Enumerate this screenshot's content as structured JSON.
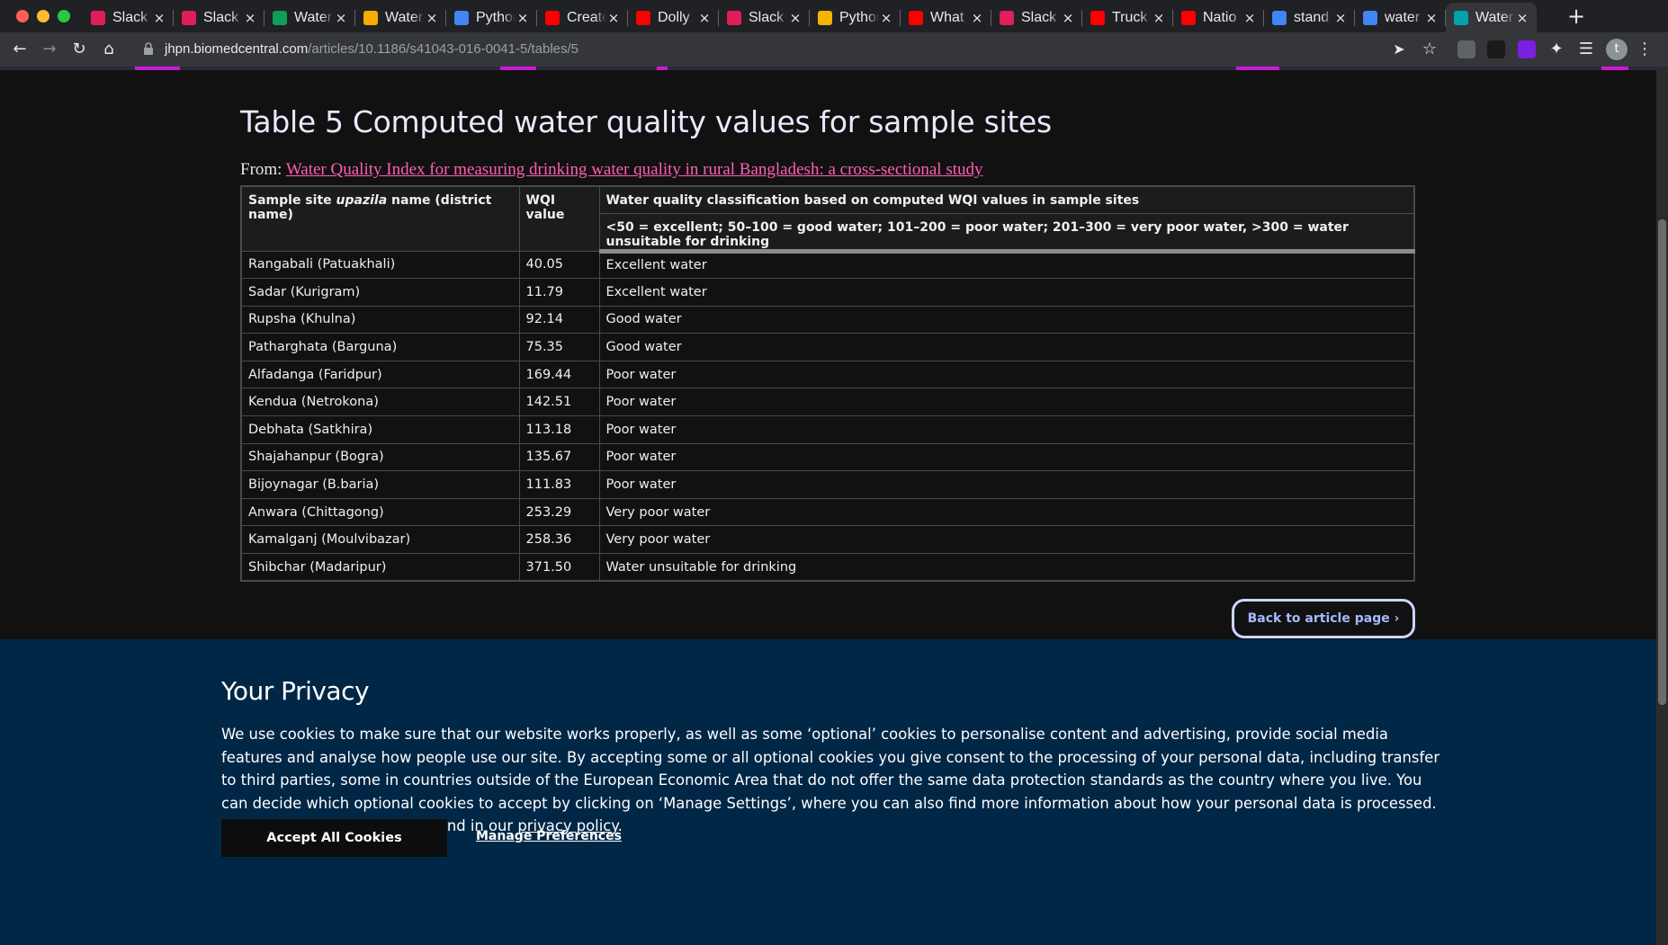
{
  "browser": {
    "tabs": [
      {
        "title": "Slack",
        "icon": "slack-icon",
        "color": "#e01e5a"
      },
      {
        "title": "Slack",
        "icon": "slack-icon",
        "color": "#e01e5a"
      },
      {
        "title": "Water",
        "icon": "sheets-icon",
        "color": "#0f9d58"
      },
      {
        "title": "Water",
        "icon": "colab-icon",
        "color": "#f9ab00"
      },
      {
        "title": "Python",
        "icon": "docs-icon",
        "color": "#4285f4"
      },
      {
        "title": "Create",
        "icon": "youtube-icon",
        "color": "#ff0000"
      },
      {
        "title": "Dolly",
        "icon": "youtube-icon",
        "color": "#ff0000"
      },
      {
        "title": "Slack",
        "icon": "slack-icon",
        "color": "#e01e5a"
      },
      {
        "title": "Python",
        "icon": "slides-icon",
        "color": "#f4b400"
      },
      {
        "title": "What",
        "icon": "youtube-icon",
        "color": "#ff0000"
      },
      {
        "title": "Slack",
        "icon": "slack-icon",
        "color": "#e01e5a"
      },
      {
        "title": "Truck",
        "icon": "youtube-icon",
        "color": "#ff0000"
      },
      {
        "title": "Natio",
        "icon": "youtube-icon",
        "color": "#ff0000"
      },
      {
        "title": "stand",
        "icon": "google-icon",
        "color": "#4285f4"
      },
      {
        "title": "water",
        "icon": "google-icon",
        "color": "#4285f4"
      },
      {
        "title": "Water",
        "icon": "biomedcentral-icon",
        "color": "#00a3ad"
      }
    ],
    "url_host": "jhpn.biomedcentral.com",
    "url_path": "/articles/10.1186/s41043-016-0041-5/tables/5",
    "profile_initial": "t"
  },
  "page": {
    "title": "Table 5 Computed water quality values for sample sites",
    "from_label": "From:",
    "from_link": "Water Quality Index for measuring drinking water quality in rural Bangladesh: a cross-sectional study",
    "table": {
      "col1_prefix": "Sample site ",
      "col1_italic": "upazila",
      "col1_suffix": " name (district name)",
      "col2": "WQI value",
      "col3": "Water quality classification based on computed WQI values in sample sites",
      "col3_sub": "<50 = excellent; 50–100 = good water; 101–200 = poor water; 201–300 = very poor water, >300 = water unsuitable for drinking",
      "rows": [
        [
          "Rangabali (Patuakhali)",
          "40.05",
          "Excellent water"
        ],
        [
          "Sadar (Kurigram)",
          "11.79",
          "Excellent water"
        ],
        [
          "Rupsha (Khulna)",
          "92.14",
          "Good water"
        ],
        [
          "Patharghata (Barguna)",
          "75.35",
          "Good water"
        ],
        [
          "Alfadanga (Faridpur)",
          "169.44",
          "Poor water"
        ],
        [
          "Kendua (Netrokona)",
          "142.51",
          "Poor water"
        ],
        [
          "Debhata (Satkhira)",
          "113.18",
          "Poor water"
        ],
        [
          "Shajahanpur (Bogra)",
          "135.67",
          "Poor water"
        ],
        [
          "Bijoynagar (B.baria)",
          "111.83",
          "Poor water"
        ],
        [
          "Anwara (Chittagong)",
          "253.29",
          "Very poor water"
        ],
        [
          "Kamalganj (Moulvibazar)",
          "258.36",
          "Very poor water"
        ],
        [
          "Shibchar (Madaripur)",
          "371.50",
          "Water unsuitable for drinking"
        ]
      ]
    },
    "back_button": "Back to article page",
    "back_chevron": "›"
  },
  "privacy": {
    "heading": "Your Privacy",
    "body": "We use cookies to make sure that our website works properly, as well as some ‘optional’ cookies to personalise content and advertising, provide social media features and analyse how people use our site. By accepting some or all optional cookies you give consent to the processing of your personal data, including transfer to third parties, some in countries outside of the European Economic Area that do not offer the same data protection standards as the country where you live. You can decide which optional cookies to accept by clicking on ‘Manage Settings’, where you can also find more information about how your personal data is processed. Further information can be found in our ",
    "link": "privacy policy",
    "end": ".",
    "accept_button": "Accept All Cookies",
    "manage_button": "Manage Preferences"
  }
}
